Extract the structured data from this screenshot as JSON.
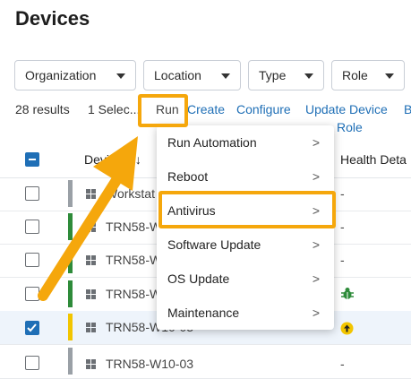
{
  "page_title": "Devices",
  "filters": [
    {
      "label": "Organization"
    },
    {
      "label": "Location"
    },
    {
      "label": "Type"
    },
    {
      "label": "Role"
    }
  ],
  "toolbar": {
    "results": "28 results",
    "selected": "1 Selec...",
    "run": "Run",
    "create": "Create",
    "configure": "Configure",
    "update_device": "Update Device",
    "update_device_line2": "Role",
    "overflow": "B"
  },
  "table": {
    "col_device": "Devic",
    "col_device_sort": "↓",
    "col_health": "Health Deta",
    "rows": [
      {
        "name": "Workstat",
        "health": "-",
        "checked": false,
        "status_color": "#9aa0a6"
      },
      {
        "name": "TRN58-W",
        "health": "-",
        "checked": false,
        "status_color": "#2e8b3a"
      },
      {
        "name": "TRN58-W",
        "health": "-",
        "checked": false,
        "status_color": "#2e8b3a"
      },
      {
        "name": "TRN58-W",
        "health": "",
        "checked": false,
        "status_color": "#2e8b3a"
      },
      {
        "name": "TRN58-W10-03",
        "health": "",
        "checked": true,
        "status_color": "#f2c500"
      },
      {
        "name": "TRN58-W10-03",
        "health": "-",
        "checked": false,
        "status_color": "#9aa0a6"
      }
    ]
  },
  "run_menu": {
    "items": [
      {
        "label": "Run Automation",
        "chevron": ">"
      },
      {
        "label": "Reboot",
        "chevron": ">"
      },
      {
        "label": "Antivirus",
        "chevron": ">"
      },
      {
        "label": "Software Update",
        "chevron": ">"
      },
      {
        "label": "OS Update",
        "chevron": ">"
      },
      {
        "label": "Maintenance",
        "chevron": ">"
      }
    ]
  },
  "icons": {
    "bug": "bug-icon",
    "update": "update-available-icon",
    "windows": "windows-icon"
  },
  "colors": {
    "accent": "#1f6fb6",
    "highlight": "#f5a70c",
    "bug_green": "#2e8b3a",
    "update_yellow": "#f2c500"
  }
}
